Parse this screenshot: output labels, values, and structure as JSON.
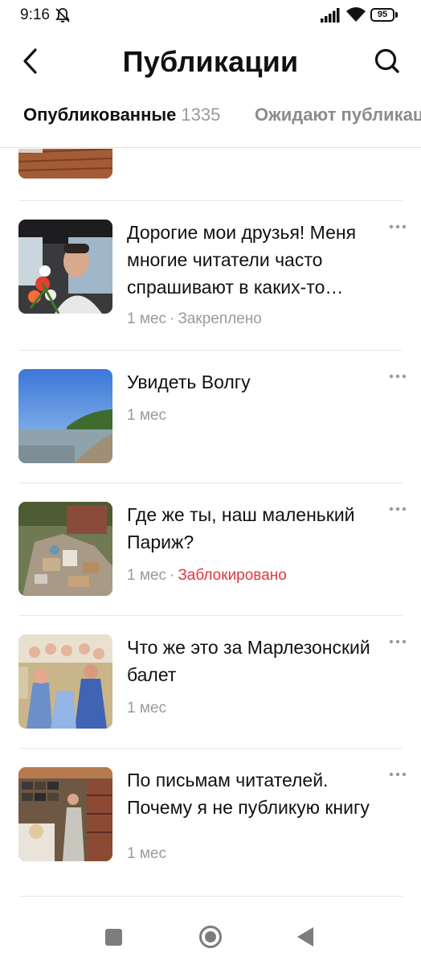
{
  "status_bar": {
    "time": "9:16",
    "battery": "95",
    "icons": [
      "bell-off-icon",
      "signal-icon",
      "wifi-icon",
      "battery-icon"
    ]
  },
  "header": {
    "title": "Публикации",
    "back_icon": "chevron-left-icon",
    "search_icon": "search-icon"
  },
  "tabs": [
    {
      "label": "Опубликованные",
      "count": "1335",
      "active": true
    },
    {
      "label": "Ожидают публикац",
      "active": false
    }
  ],
  "publications": [
    {
      "title": "Дорогие мои друзья! Меня многие читатели часто спрашивают в каких-то…",
      "age": "1 мес",
      "flag": "Закреплено",
      "flag_type": "pinned",
      "thumbnail": "person-in-car-with-flowers"
    },
    {
      "title": "Увидеть Волгу",
      "age": "1 мес",
      "flag": "",
      "thumbnail": "river-and-sky"
    },
    {
      "title": "Где же ты, наш маленький Париж?",
      "age": "1 мес",
      "flag": "Заблокировано",
      "flag_type": "blocked",
      "thumbnail": "garbage-pile"
    },
    {
      "title": "Что же это за Марлезонский балет",
      "age": "1 мес",
      "flag": "",
      "thumbnail": "costumed-group"
    },
    {
      "title": "По письмам читателей. Почему я не публикую книгу",
      "age": "1 мес",
      "flag": "",
      "thumbnail": "woman-in-bookshop"
    }
  ],
  "meta_separator": "·",
  "colors": {
    "blocked": "#e0383e",
    "muted": "#9a9a9a",
    "text": "#111111"
  },
  "nav_bar": {
    "icons": [
      "recents-square-icon",
      "home-circle-icon",
      "back-triangle-icon"
    ]
  }
}
